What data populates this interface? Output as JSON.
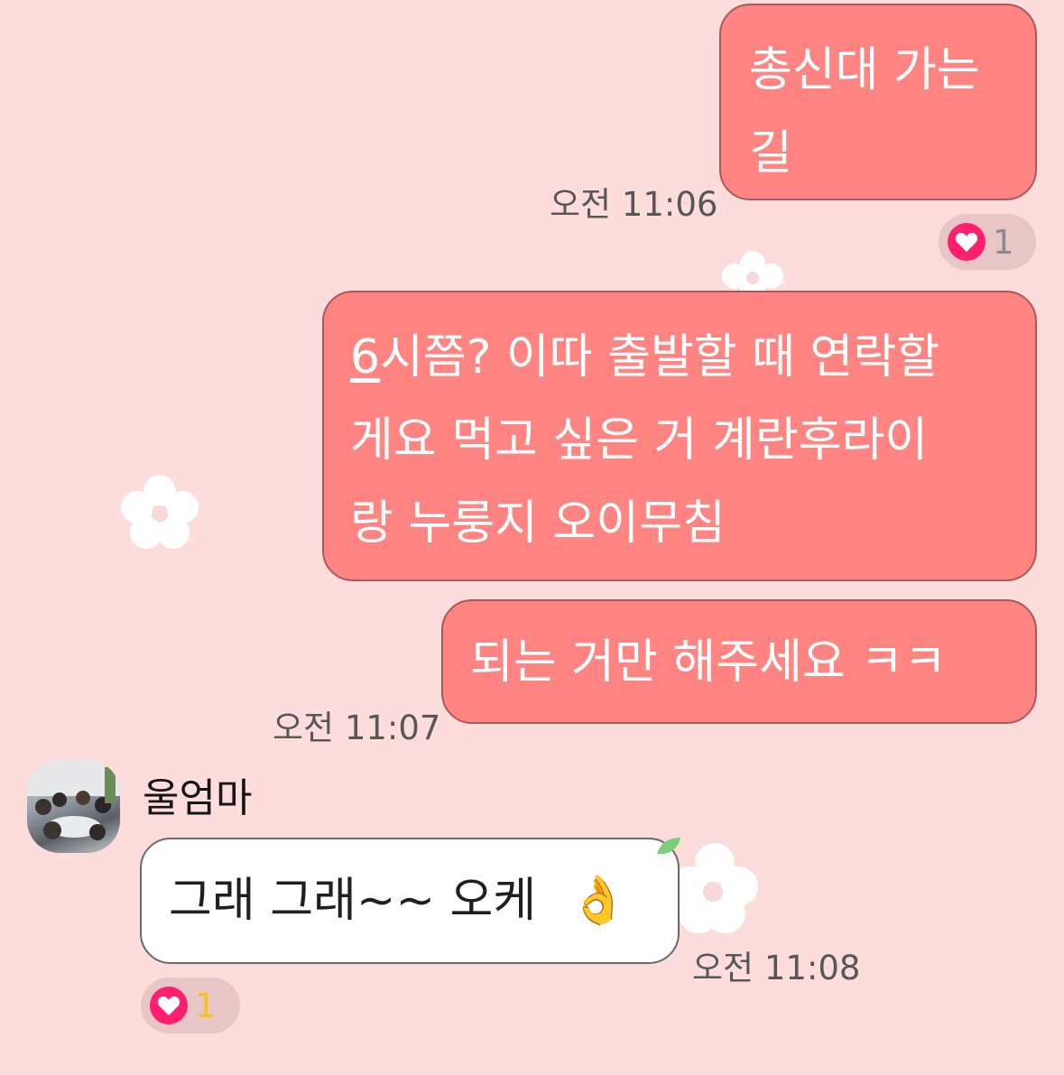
{
  "theme": {
    "background": "#fddcdc",
    "outgoing_bubble": "#ff8482",
    "incoming_bubble": "#ffffff",
    "heart": "#ff1f6e"
  },
  "messages": [
    {
      "direction": "outgoing",
      "lines": [
        "총신대 가는",
        "길"
      ],
      "time": "오전 11:06",
      "reaction": {
        "icon": "heart-icon",
        "count": "1"
      }
    },
    {
      "direction": "outgoing",
      "lines_first_prefix": "6",
      "lines": [
        "시쯤? 이따 출발할 때 연락할",
        "게요 먹고 싶은 거 계란후라이",
        "랑 누룽지 오이무침"
      ]
    },
    {
      "direction": "outgoing",
      "lines": [
        "되는 거만 해주세요 ㅋㅋ"
      ],
      "time": "오전 11:07"
    },
    {
      "direction": "incoming",
      "sender": "울엄마",
      "avatar": "group-photo-avatar",
      "text": "그래  그래~~ 오케",
      "emoji": "👌",
      "time": "오전 11:08",
      "reaction": {
        "icon": "heart-icon",
        "count": "1"
      }
    }
  ]
}
